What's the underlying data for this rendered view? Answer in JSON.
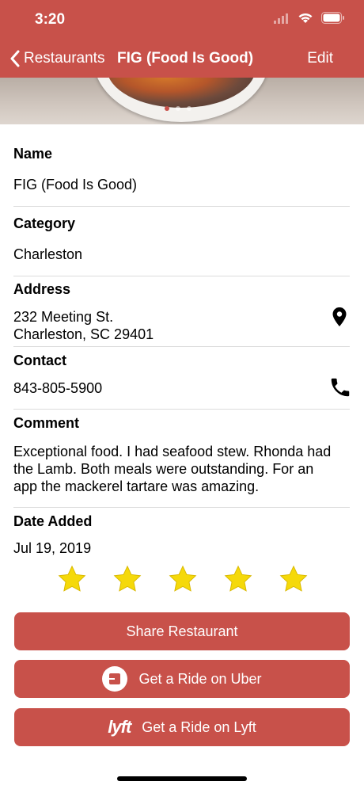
{
  "status": {
    "time": "3:20"
  },
  "nav": {
    "back_label": "Restaurants",
    "title": "FIG (Food Is Good)",
    "edit_label": "Edit"
  },
  "fields": {
    "name": {
      "label": "Name",
      "value": "FIG (Food Is Good)"
    },
    "category": {
      "label": "Category",
      "value": "Charleston"
    },
    "address": {
      "label": "Address",
      "line1": "232 Meeting St.",
      "line2": "Charleston, SC 29401"
    },
    "contact": {
      "label": "Contact",
      "value": "843-805-5900"
    },
    "comment": {
      "label": "Comment",
      "line1": "Exceptional food. I had seafood stew. Rhonda had",
      "line2": "the Lamb. Both meals were outstanding. For an",
      "line3": "app the mackerel tartare was amazing."
    },
    "date_added": {
      "label": "Date Added",
      "value": "Jul 19, 2019"
    }
  },
  "rating": {
    "value": 5,
    "max": 5
  },
  "buttons": {
    "share": "Share Restaurant",
    "uber": "Get a Ride on Uber",
    "lyft": "Get a Ride on Lyft",
    "lyft_logo": "lyft"
  },
  "colors": {
    "accent": "#c8514a",
    "star": "#f5d90a"
  },
  "icons": [
    "chevron-left-icon",
    "wifi-icon",
    "battery-icon",
    "location-pin-icon",
    "phone-icon",
    "star-icon",
    "uber-icon",
    "lyft-icon"
  ]
}
